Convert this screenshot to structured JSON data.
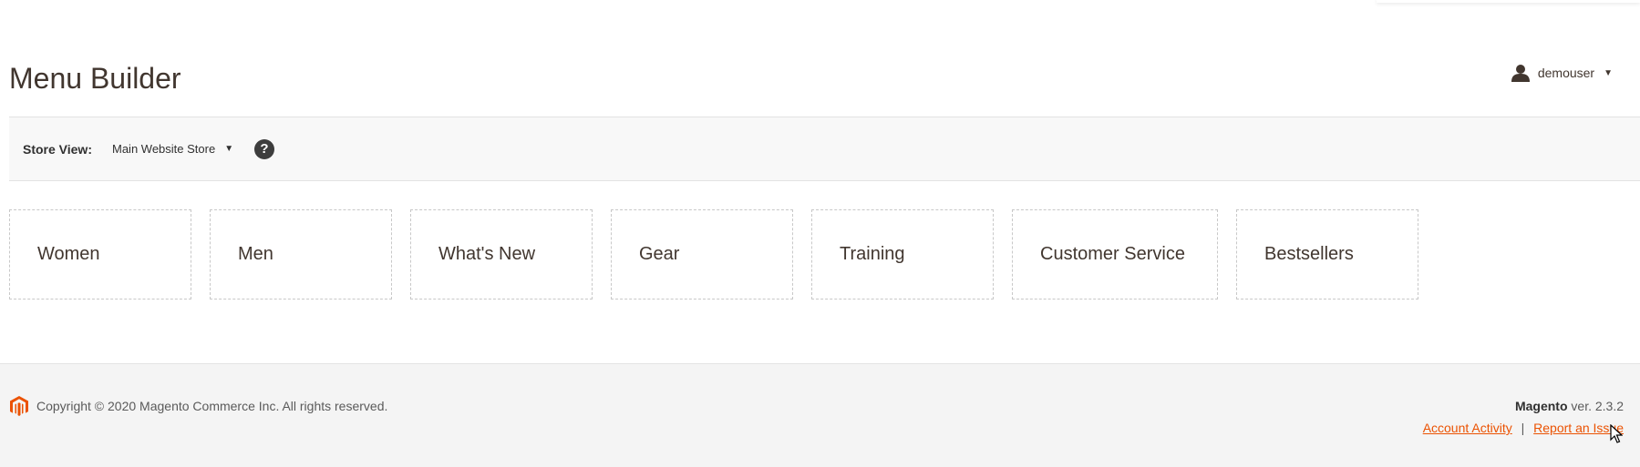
{
  "header": {
    "title": "Menu Builder",
    "user": {
      "name": "demouser",
      "icon": "user-icon"
    }
  },
  "store_view": {
    "label": "Store View:",
    "selected": "Main Website Store",
    "help_icon": "help-icon"
  },
  "menu_items": [
    {
      "label": "Women"
    },
    {
      "label": "Men"
    },
    {
      "label": "What's New"
    },
    {
      "label": "Gear"
    },
    {
      "label": "Training"
    },
    {
      "label": "Customer Service"
    },
    {
      "label": "Bestsellers"
    }
  ],
  "footer": {
    "copyright": "Copyright © 2020 Magento Commerce Inc. All rights reserved.",
    "brand": "Magento",
    "version": "ver. 2.3.2",
    "links": {
      "account_activity": "Account Activity",
      "separator": "|",
      "report_issue": "Report an Issue"
    }
  },
  "colors": {
    "accent": "#eb5202",
    "title": "#41362f",
    "bar_bg": "#f8f8f8",
    "footer_bg": "#f4f4f4"
  }
}
